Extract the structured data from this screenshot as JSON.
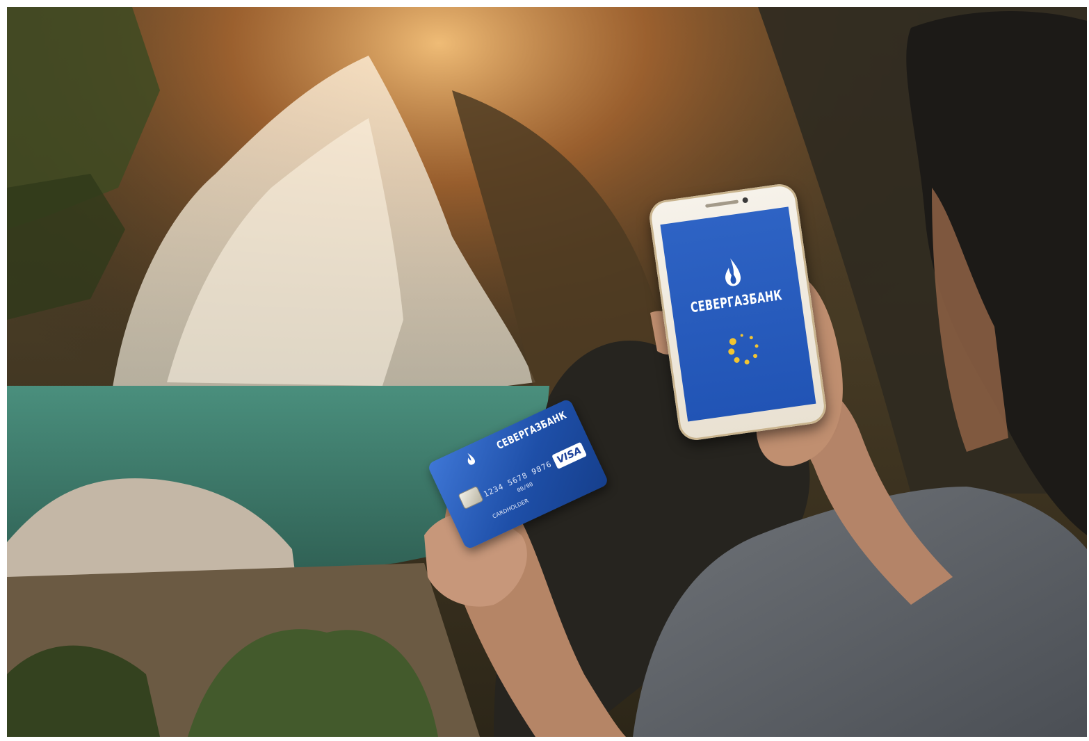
{
  "scene": {
    "description_colors": {
      "water": "#3f8a78",
      "sunlight": "#f2b56b",
      "card_blue": "#1e4fa8",
      "screen_blue": "#2154b5",
      "spinner_yellow": "#f2c431"
    }
  },
  "card": {
    "bank_name": "СЕВЕРГАЗБАНК",
    "number": "1234 5678 9876 5432",
    "valid": "00/00",
    "holder": "CARDHOLDER",
    "network": "VISA"
  },
  "phone": {
    "bank_name": "СЕВЕРГАЗБАНК",
    "loading_icon": "spinner-icon",
    "logo_icon": "flame-icon"
  }
}
